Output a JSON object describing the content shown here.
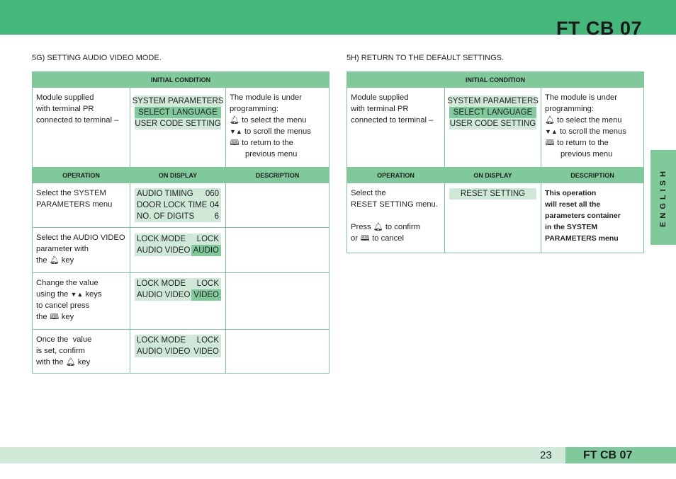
{
  "header": {
    "brand": "FT CB 07"
  },
  "left": {
    "title": "5G) SETTING AUDIO VIDEO MODE.",
    "initial_condition_label": "INITIAL CONDITION",
    "initial": {
      "operation": [
        "Module supplied",
        "with terminal PR",
        "connected to terminal –"
      ],
      "display": [
        {
          "text": "SYSTEM PARAMETERS",
          "highlight": false
        },
        {
          "text": "SELECT LANGUAGE",
          "highlight": true
        },
        {
          "text": "USER CODE SETTING",
          "highlight": false
        }
      ],
      "description": {
        "intro1": "The module is under",
        "intro2": "programming:",
        "bell": "to select the menu",
        "arrows": "to scroll the menus",
        "book1": "to return to the",
        "book2": "previous menu"
      }
    },
    "columns": {
      "operation": "OPERATION",
      "display": "ON DISPLAY",
      "description": "DESCRIPTION"
    },
    "steps": [
      {
        "op": [
          "Select the SYSTEM",
          "PARAMETERS menu"
        ],
        "display": [
          {
            "label": "AUDIO TIMING",
            "value": "060"
          },
          {
            "label": "DOOR LOCK TIME",
            "value": "04"
          },
          {
            "label": "NO. OF DIGITS",
            "value": "6"
          }
        ]
      },
      {
        "op": [
          "Select the AUDIO VIDEO",
          "parameter with",
          "the",
          "key"
        ],
        "display": [
          {
            "label": "LOCK MODE",
            "value": "LOCK"
          },
          {
            "label": "AUDIO VIDEO",
            "value": "AUDIO",
            "value_highlight": true
          }
        ]
      },
      {
        "op": [
          "Change the value",
          "using the",
          "keys",
          "to cancel press",
          "the",
          "key"
        ],
        "display": [
          {
            "label": "LOCK MODE",
            "value": "LOCK"
          },
          {
            "label": "AUDIO VIDEO",
            "value": "VIDEO",
            "value_highlight": true
          }
        ]
      },
      {
        "op": [
          "Once the  value",
          "is set, confirm",
          "with the",
          "key"
        ],
        "display": [
          {
            "label": "LOCK MODE",
            "value": "LOCK"
          },
          {
            "label": "AUDIO VIDEO",
            "value": "VIDEO"
          }
        ]
      }
    ]
  },
  "right": {
    "title": "5H) RETURN TO THE DEFAULT SETTINGS.",
    "initial_condition_label": "INITIAL CONDITION",
    "columns": {
      "operation": "OPERATION",
      "display": "ON DISPLAY",
      "description": "DESCRIPTION"
    },
    "step": {
      "op1": "Select the",
      "op2": "RESET SETTING menu.",
      "press": "Press",
      "confirm": "to confirm",
      "or": "or",
      "cancel": "to cancel",
      "display": "RESET SETTING",
      "description": [
        "This operation",
        "will reset all the",
        "parameters container",
        "in the SYSTEM",
        "PARAMETERS menu"
      ]
    }
  },
  "side_tab": {
    "label": "ENGLISH"
  },
  "footer": {
    "page": "23",
    "brand": "FT CB 07"
  },
  "icons": {
    "bell": "bell-icon",
    "arrows": "down-up-arrows-icon",
    "book": "book-icon"
  },
  "colors": {
    "header_green": "#45b97c",
    "table_green": "#7fc99a",
    "light_green": "#cfe8d8"
  }
}
